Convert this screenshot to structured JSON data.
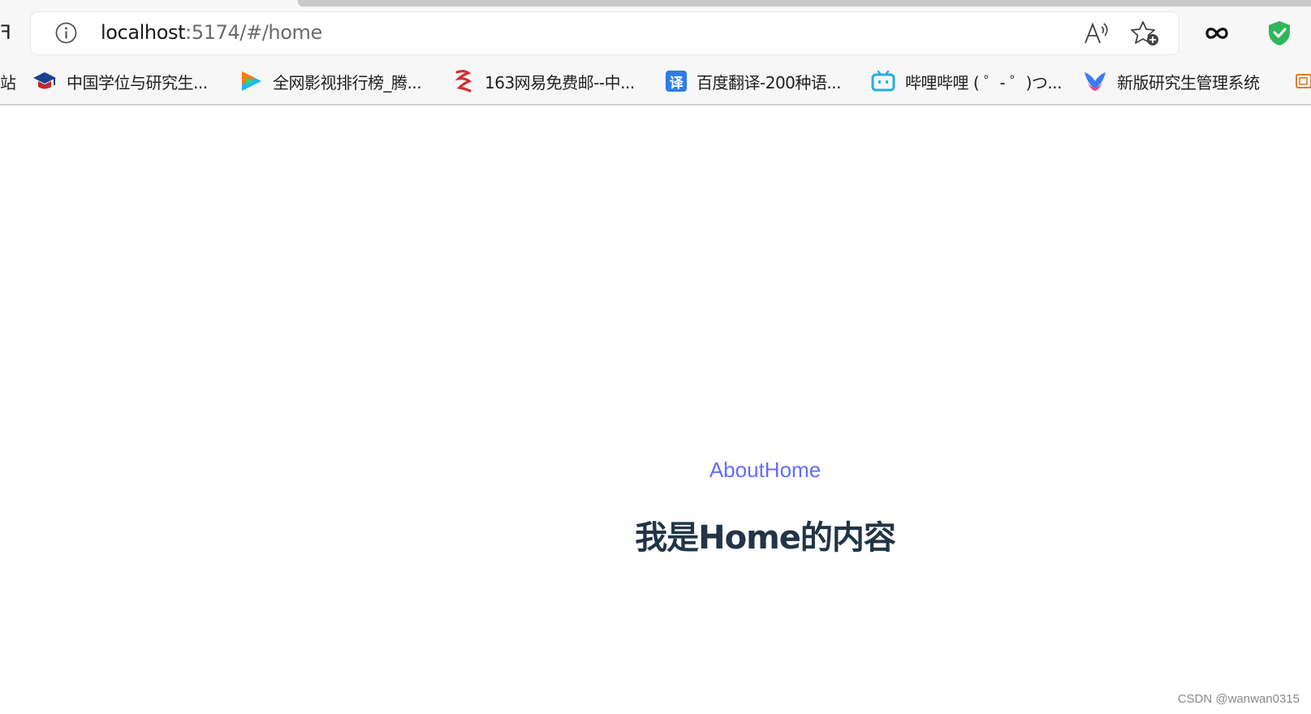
{
  "browser": {
    "url_host": "localhost",
    "url_rest": ":5174/#/home",
    "back_fragment": "ꟻ",
    "bookmarks_fragment": "站",
    "icons": {
      "info": "info-circle-icon",
      "read_aloud": "read-aloud-icon",
      "favorite": "add-favorite-star-icon",
      "extension": "infinity-icon",
      "security": "green-shield-check-icon"
    }
  },
  "bookmarks": [
    {
      "label": "中国学位与研究生...",
      "icon": "graduation-cap-icon"
    },
    {
      "label": "全网影视排行榜_腾...",
      "icon": "tencent-video-play-icon"
    },
    {
      "label": "163网易免费邮--中...",
      "icon": "netease-mail-icon"
    },
    {
      "label": "百度翻译-200种语...",
      "icon_text": "译",
      "icon": "baidu-translate-icon"
    },
    {
      "label": "哔哩哔哩 ( ゜- ゜)つ...",
      "icon": "bilibili-tv-icon"
    },
    {
      "label": "新版研究生管理系统",
      "icon": "bird-logo-icon"
    }
  ],
  "page": {
    "nav_about": "About",
    "nav_home": "Home",
    "heading": "我是Home的内容"
  },
  "watermark": "CSDN @wanwan0315",
  "colors": {
    "link": "#646cff",
    "heading": "#213547",
    "shield": "#2fb65a"
  }
}
